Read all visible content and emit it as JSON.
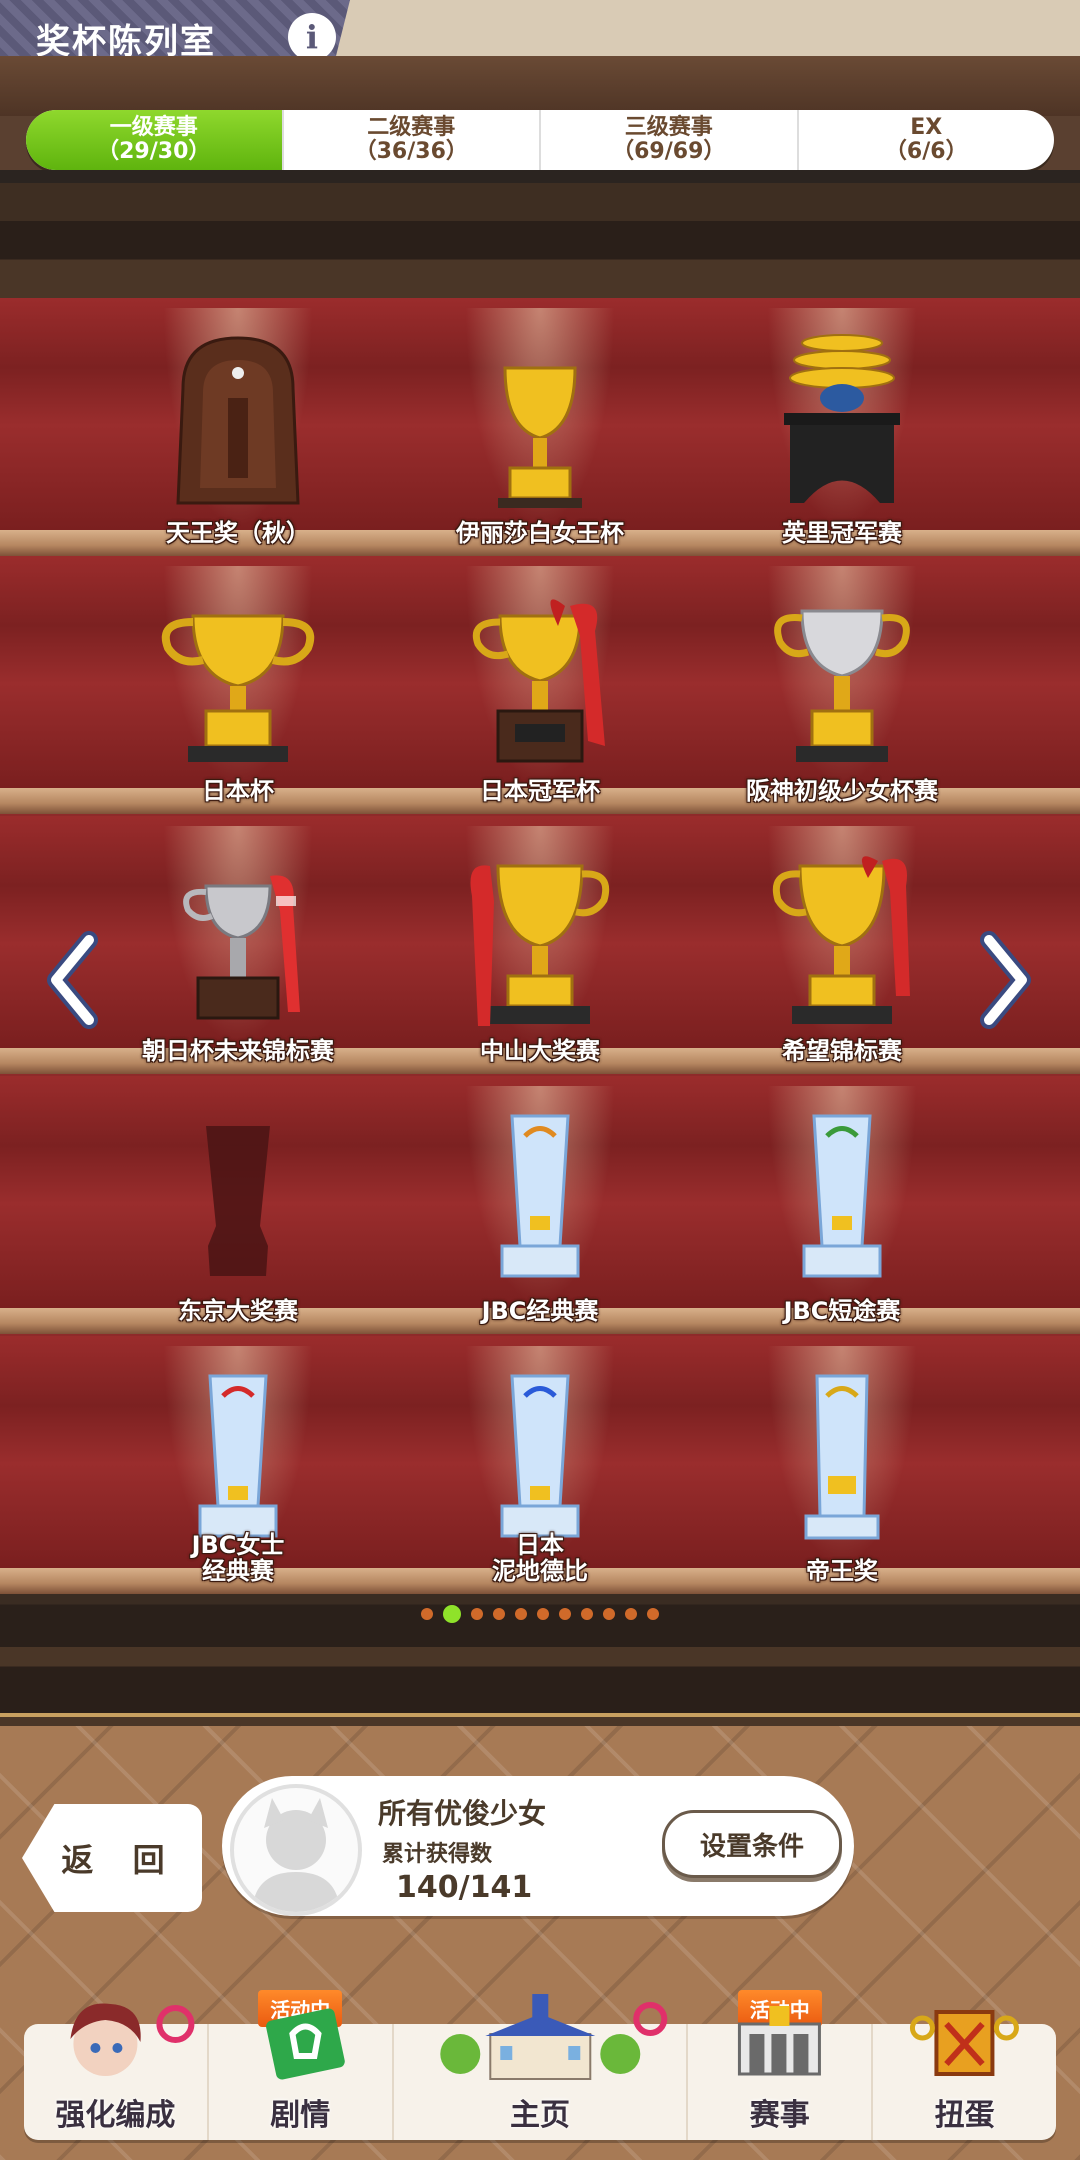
{
  "header": {
    "title": "奖杯陈列室",
    "info_label": "i"
  },
  "tabs": [
    {
      "label": "一级赛事",
      "count": "（29/30）",
      "active": true
    },
    {
      "label": "二级赛事",
      "count": "（36/36）",
      "active": false
    },
    {
      "label": "三级赛事",
      "count": "（69/69）",
      "active": false
    },
    {
      "label": "EX",
      "count": "（6/6）",
      "active": false
    }
  ],
  "trophies": [
    {
      "name": "天王奖（秋）",
      "icon": "horseshoe-plaque-trophy-icon"
    },
    {
      "name": "伊丽莎白女王杯",
      "icon": "gold-cup-trophy-icon"
    },
    {
      "name": "英里冠军赛",
      "icon": "pagoda-trophy-icon"
    },
    {
      "name": "日本杯",
      "icon": "gold-cup-trophy-icon"
    },
    {
      "name": "日本冠军杯",
      "icon": "gold-cup-ribbon-trophy-icon"
    },
    {
      "name": "阪神初级少女杯赛",
      "icon": "silver-gold-cup-trophy-icon"
    },
    {
      "name": "朝日杯未来锦标赛",
      "icon": "silver-cup-ribbon-trophy-icon"
    },
    {
      "name": "中山大奖赛",
      "icon": "gold-cup-ribbon-trophy-icon"
    },
    {
      "name": "希望锦标赛",
      "icon": "gold-cup-ribbon-trophy-icon"
    },
    {
      "name": "东京大奖赛",
      "icon": "locked-trophy-silhouette-icon"
    },
    {
      "name": "JBC经典赛",
      "icon": "crystal-trophy-icon"
    },
    {
      "name": "JBC短途赛",
      "icon": "crystal-trophy-icon"
    },
    {
      "name": "JBC女士经典赛",
      "line1": "JBC女士",
      "line2": "经典赛",
      "icon": "crystal-trophy-icon"
    },
    {
      "name": "日本泥地德比",
      "line1": "日本",
      "line2": "泥地德比",
      "icon": "crystal-trophy-icon"
    },
    {
      "name": "帝王奖",
      "icon": "crystal-trophy-icon"
    }
  ],
  "pagination": {
    "total": 11,
    "current": 2
  },
  "back_button": {
    "label": "返 回"
  },
  "filter": {
    "title": "所有优俊少女",
    "subtitle": "累计获得数",
    "count": "140/141",
    "settings_label": "设置条件"
  },
  "bottom_nav": [
    {
      "label": "强化编成",
      "badge": "",
      "icon": "character-portrait-icon"
    },
    {
      "label": "剧情",
      "badge": "活动中",
      "icon": "story-book-icon"
    },
    {
      "label": "主页",
      "badge": "",
      "icon": "home-building-icon"
    },
    {
      "label": "赛事",
      "badge": "活动中",
      "icon": "race-gate-icon"
    },
    {
      "label": "扭蛋",
      "badge": "",
      "icon": "gacha-icon"
    }
  ],
  "colors": {
    "tab_active": "#6cc41a",
    "shelf_red": "#8e2a2a",
    "badge_orange": "#f07020",
    "dot_active": "#8fe22a",
    "dot_inactive": "#d06a2a"
  }
}
